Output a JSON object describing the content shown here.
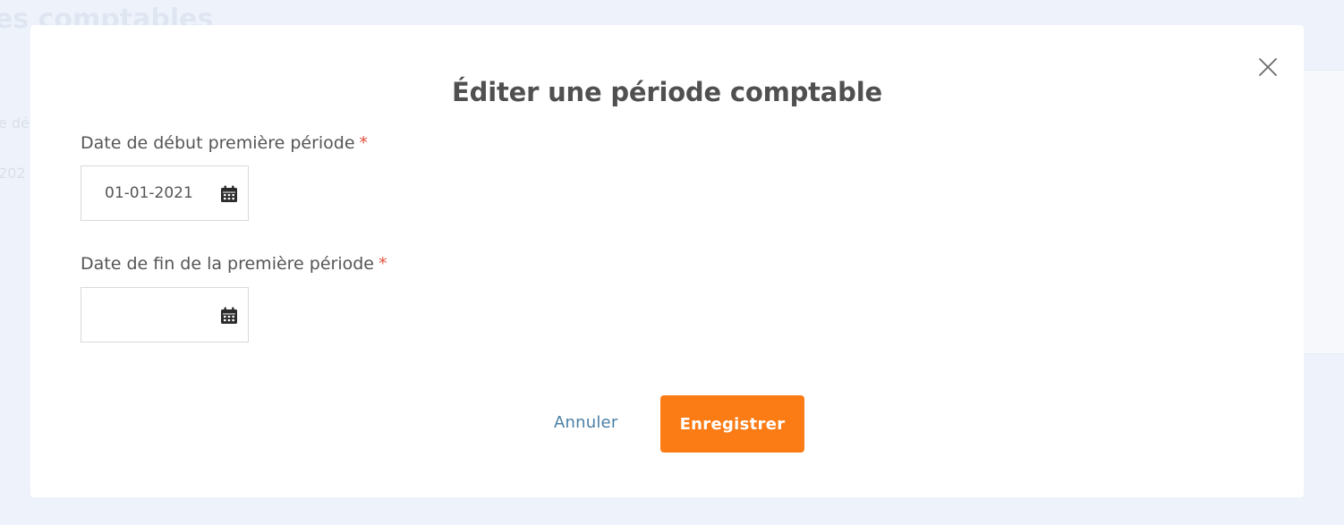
{
  "background": {
    "title_fragment": "es comptables",
    "text_fragment_1": "e dé",
    "text_fragment_2": "202"
  },
  "modal": {
    "title": "Éditer une période comptable",
    "close_icon": "close-icon",
    "fields": {
      "start": {
        "label": "Date de début première période",
        "required_mark": "*",
        "value": "01-01-2021",
        "icon": "calendar-icon"
      },
      "end": {
        "label": "Date de fin de la première période",
        "required_mark": "*",
        "value": "",
        "icon": "calendar-icon"
      }
    },
    "actions": {
      "cancel_label": "Annuler",
      "save_label": "Enregistrer"
    }
  },
  "colors": {
    "accent": "#fb7b15",
    "link": "#4a7fa6",
    "required": "#e0533f",
    "text": "#555555",
    "overlay_bg": "#eef3fb"
  }
}
